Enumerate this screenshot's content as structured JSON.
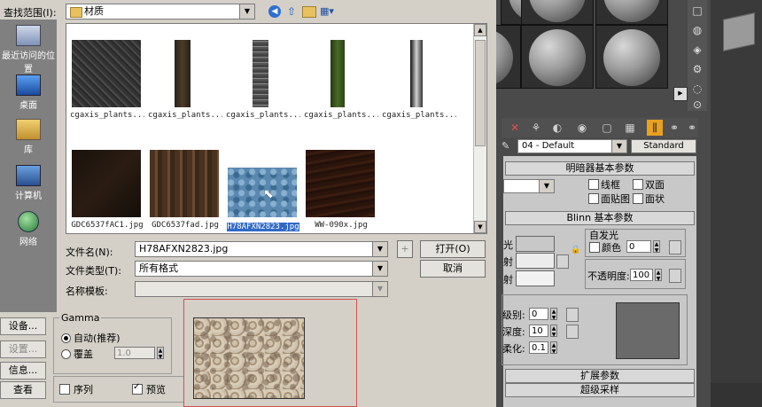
{
  "dialog": {
    "look_in_label": "查找范围(I):",
    "look_in_value": "材质",
    "places": [
      "最近访问的位置",
      "桌面",
      "库",
      "计算机",
      "网络"
    ],
    "files": [
      {
        "name": "cgaxis_plants...",
        "selected": false
      },
      {
        "name": "cgaxis_plants...",
        "selected": false
      },
      {
        "name": "cgaxis_plants...",
        "selected": false
      },
      {
        "name": "cgaxis_plants...",
        "selected": false
      },
      {
        "name": "cgaxis_plants...",
        "selected": false
      },
      {
        "name": "GDC6537fAC1.jpg",
        "selected": false
      },
      {
        "name": "GDC6537fad.jpg",
        "selected": false
      },
      {
        "name": "H78AFXN2823.jpg",
        "selected": true
      },
      {
        "name": "WW-090x.jpg",
        "selected": false
      }
    ],
    "filename_label": "文件名(N):",
    "filename_value": "H78AFXN2823.jpg",
    "filetype_label": "文件类型(T):",
    "filetype_value": "所有格式",
    "template_label": "名称模板:",
    "template_value": "",
    "open_button": "打开(O)",
    "cancel_button": "取消",
    "plus_button": "+",
    "side_buttons": [
      "设备...",
      "设置...",
      "信息...",
      "查看"
    ],
    "gamma": {
      "title": "Gamma",
      "auto_label": "自动(推荐)",
      "override_label": "覆盖",
      "override_value": "1.0"
    },
    "sequence_label": "序列",
    "preview_label": "预览"
  },
  "material_editor": {
    "material_name": "04 - Default",
    "shader_type": "Standard",
    "rollouts": {
      "shader_basic": "明暗器基本参数",
      "blinn_basic": "Blinn 基本参数",
      "extended": "扩展参数",
      "supersampling": "超级采样"
    },
    "options": {
      "wire": "线框",
      "two_sided": "双面",
      "face_map": "面贴图",
      "faceted": "面状"
    },
    "self_illum": {
      "title": "自发光",
      "color_label": "颜色",
      "value": "0"
    },
    "opacity_label": "不透明度:",
    "opacity_value": "100",
    "specular": {
      "level_label": "级别:",
      "level_value": "0",
      "gloss_label": "深度:",
      "gloss_value": "10",
      "soften_label": "柔化:",
      "soften_value": "0.1"
    },
    "partial_labels": [
      "光",
      "射",
      "射"
    ]
  }
}
